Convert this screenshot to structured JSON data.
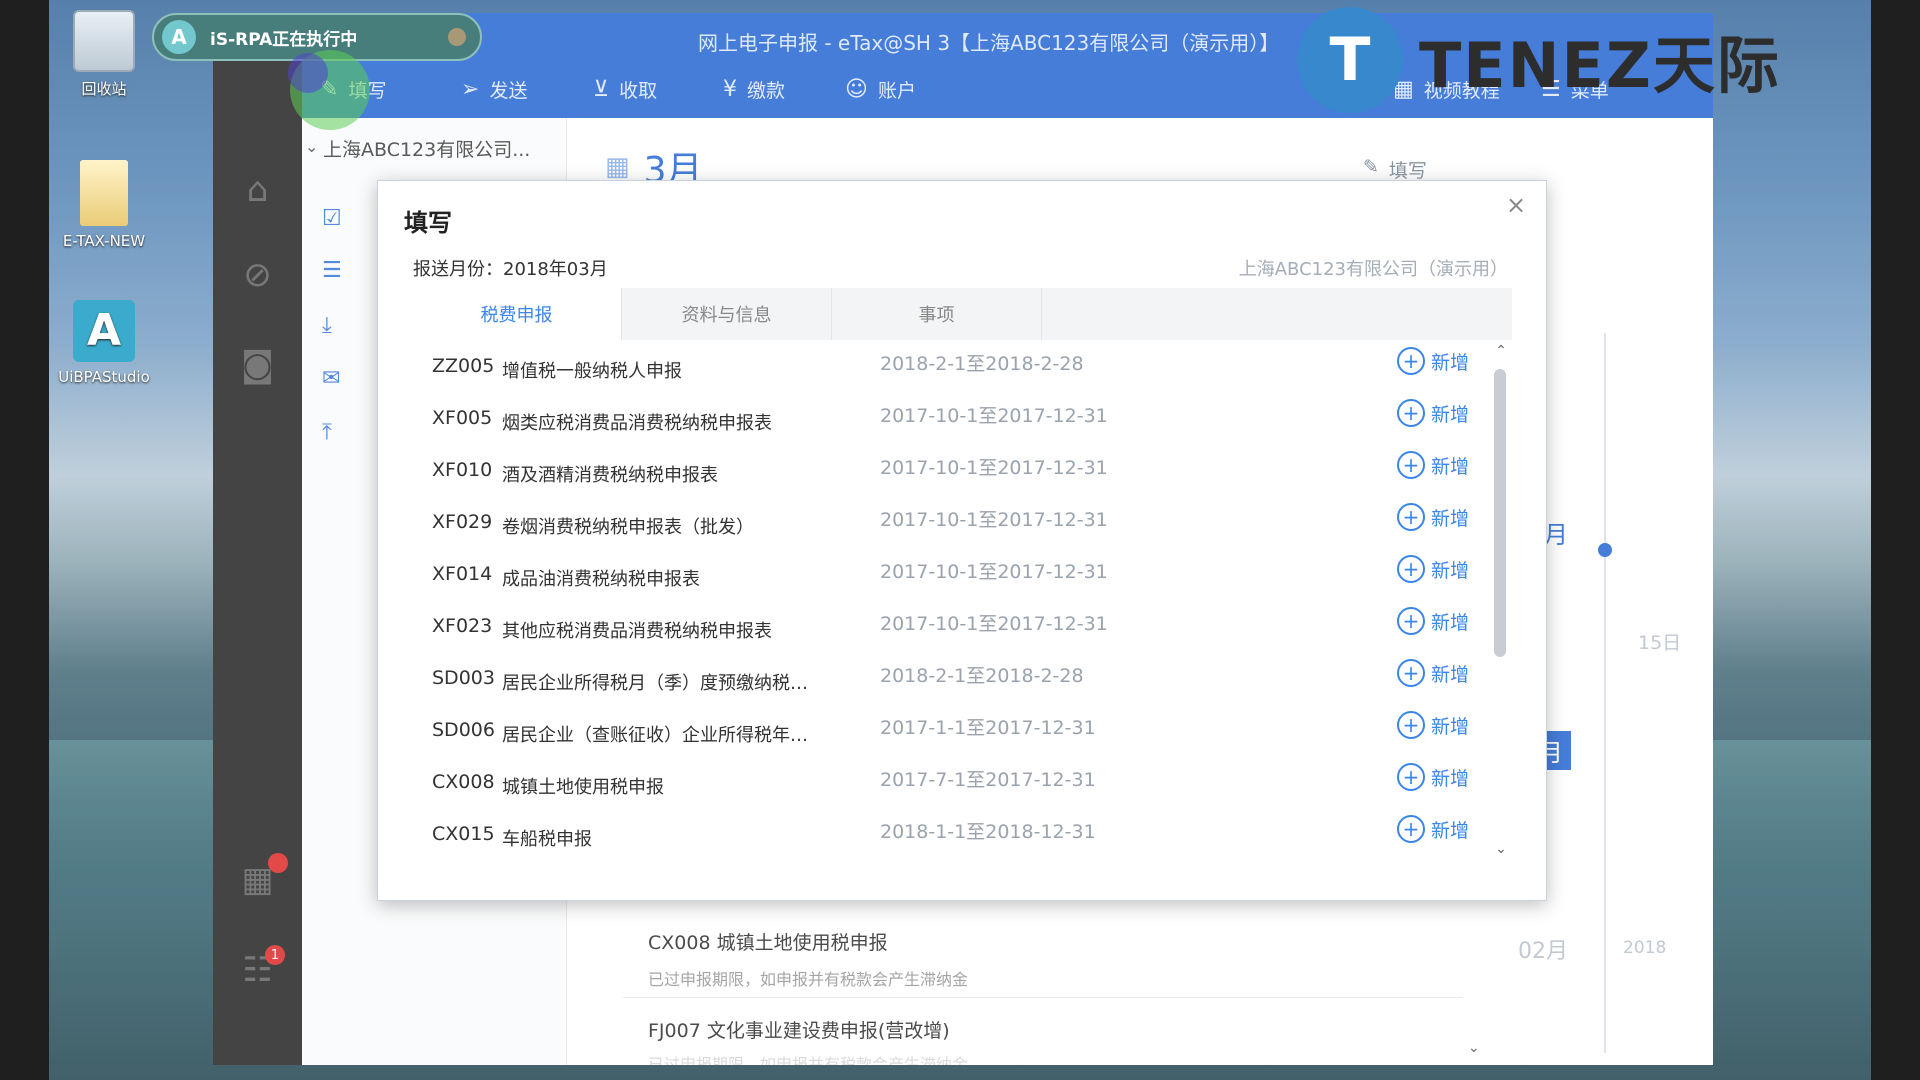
{
  "desktop": {
    "icons": [
      {
        "label": "回收站",
        "icon": "recycle-bin-icon"
      },
      {
        "label": "E-TAX-NEW",
        "icon": "folder-icon"
      },
      {
        "label": "UiBPAStudio",
        "icon": "app-icon"
      }
    ]
  },
  "rpa_badge": {
    "text": "iS-RPA正在执行中"
  },
  "logo": {
    "text": "TENEZ天际"
  },
  "window": {
    "title": "网上电子申报 - eTax@SH 3【上海ABC123有限公司（演示用）】",
    "toolbar": [
      {
        "label": "填写",
        "icon": "edit-icon"
      },
      {
        "label": "发送",
        "icon": "send-icon"
      },
      {
        "label": "收取",
        "icon": "download-icon"
      },
      {
        "label": "缴款",
        "icon": "yen-icon"
      },
      {
        "label": "账户",
        "icon": "user-icon"
      }
    ],
    "toolbar_right": [
      {
        "label": "视频教程",
        "icon": "video-icon"
      },
      {
        "label": "菜单",
        "icon": "menu-icon"
      }
    ],
    "leftbar_badge": "1"
  },
  "main": {
    "company": "上海ABC123有限公司...",
    "month": "3月",
    "fill_label": "填写",
    "timeline": {
      "month_a": "月",
      "day_label": "15日",
      "month_b": "月",
      "feb_label": "02月",
      "year_label": "2018"
    },
    "bg_items": [
      {
        "title": "CX008 城镇土地使用税申报",
        "sub": "已过申报期限，如申报并有税款会产生滞纳金"
      },
      {
        "title": "FJ007 文化事业建设费申报(营改增)",
        "sub": "已过申报期限，如申报并有税款会产生滞纳金"
      }
    ]
  },
  "dialog": {
    "title": "填写",
    "period_label": "报送月份：2018年03月",
    "company": "上海ABC123有限公司（演示用）",
    "tabs": [
      "税费申报",
      "资料与信息",
      "事项"
    ],
    "add_label": "新增",
    "rows": [
      {
        "code": "ZZ005",
        "name": "增值税一般纳税人申报",
        "period": "2018-2-1至2018-2-28"
      },
      {
        "code": "XF005",
        "name": "烟类应税消费品消费税纳税申报表",
        "period": "2017-10-1至2017-12-31"
      },
      {
        "code": "XF010",
        "name": "酒及酒精消费税纳税申报表",
        "period": "2017-10-1至2017-12-31"
      },
      {
        "code": "XF029",
        "name": "卷烟消费税纳税申报表（批发）",
        "period": "2017-10-1至2017-12-31"
      },
      {
        "code": "XF014",
        "name": "成品油消费税纳税申报表",
        "period": "2017-10-1至2017-12-31"
      },
      {
        "code": "XF023",
        "name": "其他应税消费品消费税纳税申报表",
        "period": "2017-10-1至2017-12-31"
      },
      {
        "code": "SD003",
        "name": "居民企业所得税月（季）度预缴纳税申...",
        "period": "2018-2-1至2018-2-28"
      },
      {
        "code": "SD006",
        "name": "居民企业（查账征收）企业所得税年度...",
        "period": "2017-1-1至2017-12-31"
      },
      {
        "code": "CX008",
        "name": "城镇土地使用税申报",
        "period": "2017-7-1至2017-12-31"
      },
      {
        "code": "CX015",
        "name": "车船税申报",
        "period": "2018-1-1至2018-12-31"
      }
    ]
  }
}
